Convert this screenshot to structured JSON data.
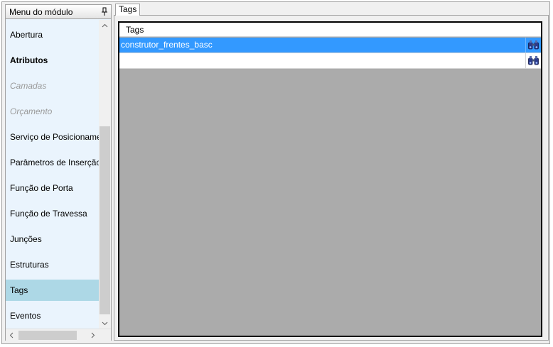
{
  "menu": {
    "title": "Menu do módulo",
    "items": [
      {
        "label": "Abertura",
        "style": "normal"
      },
      {
        "label": "Atributos",
        "style": "bold"
      },
      {
        "label": "Camadas",
        "style": "disabled"
      },
      {
        "label": "Orçamento",
        "style": "disabled"
      },
      {
        "label": "Serviço de Posicionamento",
        "style": "normal"
      },
      {
        "label": "Parâmetros de Inserção",
        "style": "normal"
      },
      {
        "label": "Função de Porta",
        "style": "normal"
      },
      {
        "label": "Função de Travessa",
        "style": "normal"
      },
      {
        "label": "Junções",
        "style": "normal"
      },
      {
        "label": "Estruturas",
        "style": "normal"
      },
      {
        "label": "Tags",
        "style": "selected"
      },
      {
        "label": "Eventos",
        "style": "normal"
      }
    ]
  },
  "tabs": [
    {
      "label": "Tags",
      "active": true
    }
  ],
  "grid": {
    "column_header": "Tags",
    "rows": [
      {
        "value": "construtor_frentes_basc",
        "selected": true
      },
      {
        "value": "",
        "selected": false
      }
    ]
  },
  "icons": {
    "pin": "pin-icon",
    "find": "binoculars-icon",
    "scroll_up": "chevron-up-icon",
    "scroll_down": "chevron-down-icon",
    "scroll_left": "chevron-left-icon",
    "scroll_right": "chevron-right-icon"
  },
  "colors": {
    "selection": "#3399ff",
    "menu_selected": "#add8e6",
    "menu_background": "#eaf4fd",
    "grid_background": "#ababab"
  }
}
